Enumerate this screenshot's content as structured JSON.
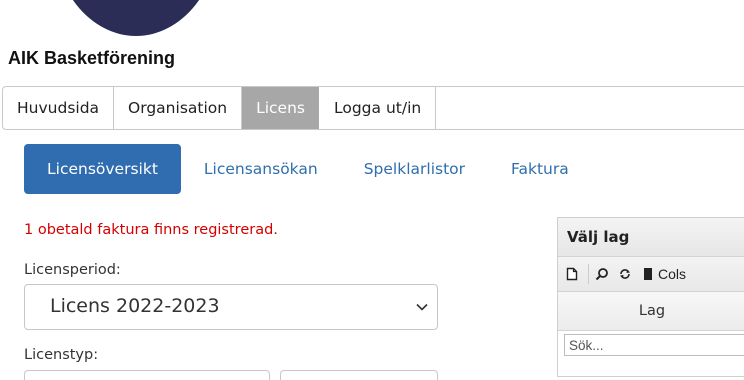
{
  "brand": {
    "org_name": "AIK Basketförening",
    "logo_color": "#2b2d57"
  },
  "topnav": {
    "items": [
      {
        "label": "Huvudsida",
        "active": false
      },
      {
        "label": "Organisation",
        "active": false
      },
      {
        "label": "Licens",
        "active": true
      },
      {
        "label": "Logga ut/in",
        "active": false
      }
    ]
  },
  "subnav": {
    "items": [
      {
        "label": "Licensöversikt",
        "active": true
      },
      {
        "label": "Licensansökan",
        "active": false
      },
      {
        "label": "Spelklarlistor",
        "active": false
      },
      {
        "label": "Faktura",
        "active": false
      }
    ]
  },
  "alert": {
    "text": "1 obetald faktura finns registrerad.",
    "color": "#d40000"
  },
  "form": {
    "period_label": "Licensperiod:",
    "period_value": "Licens 2022-2023",
    "type_label": "Licenstyp:"
  },
  "team_panel": {
    "title": "Välj lag",
    "toolbar": {
      "icons": [
        "new-icon",
        "search-icon",
        "refresh-icon",
        "columns-icon"
      ],
      "cols_label": "Cols"
    },
    "column_header": "Lag",
    "search_placeholder": "Sök..."
  },
  "colors": {
    "accent": "#2f6db0",
    "link": "#2f6fad",
    "active_tab": "#a7a7a7"
  }
}
